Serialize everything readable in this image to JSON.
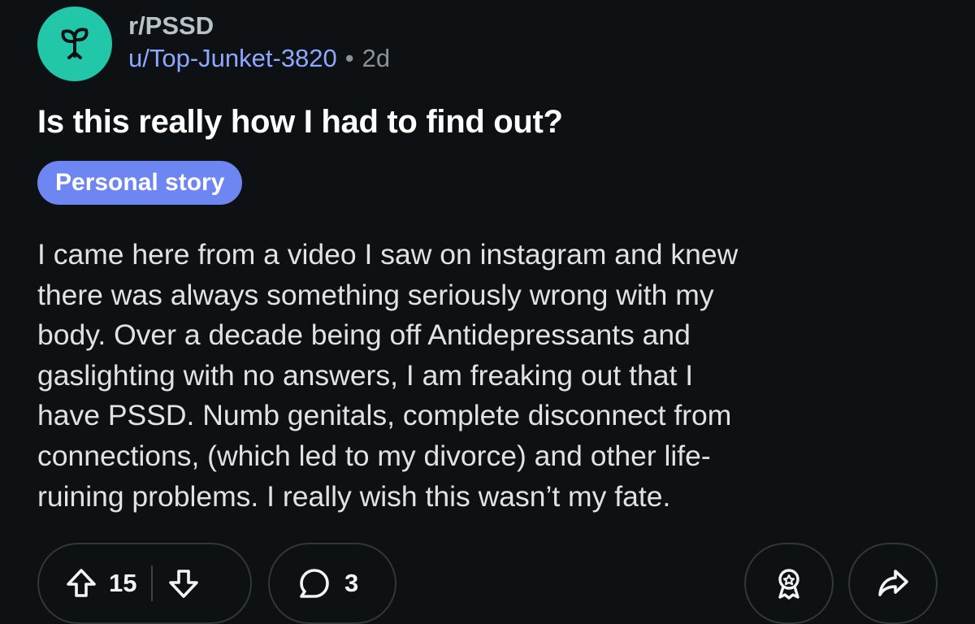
{
  "post": {
    "subreddit": "r/PSSD",
    "author": "u/Top-Junket-3820",
    "separator": "•",
    "age": "2d",
    "title": "Is this really how I had to find out?",
    "flair": "Personal story",
    "body": "I came here from a video I saw on instagram and knew\nthere was always something seriously wrong with my\nbody. Over a decade being off Antidepressants and\ngaslighting with no answers, I am freaking out that I\nhave PSSD. Numb genitals, complete disconnect from\nconnections, (which led to my divorce) and other life-\nruining problems. I really wish this wasn’t my fate."
  },
  "actions": {
    "upvote_icon": "upvote-arrow-icon",
    "vote_count": "15",
    "downvote_icon": "downvote-arrow-icon",
    "comment_icon": "comment-bubble-icon",
    "comment_count": "3",
    "award_icon": "award-icon",
    "share_icon": "share-arrow-icon"
  },
  "colors": {
    "background": "#0e1113",
    "avatar": "#22c7a9",
    "author_link": "#8ea8ff",
    "flair": "#6e86f2",
    "pill_border": "#2f383d"
  }
}
